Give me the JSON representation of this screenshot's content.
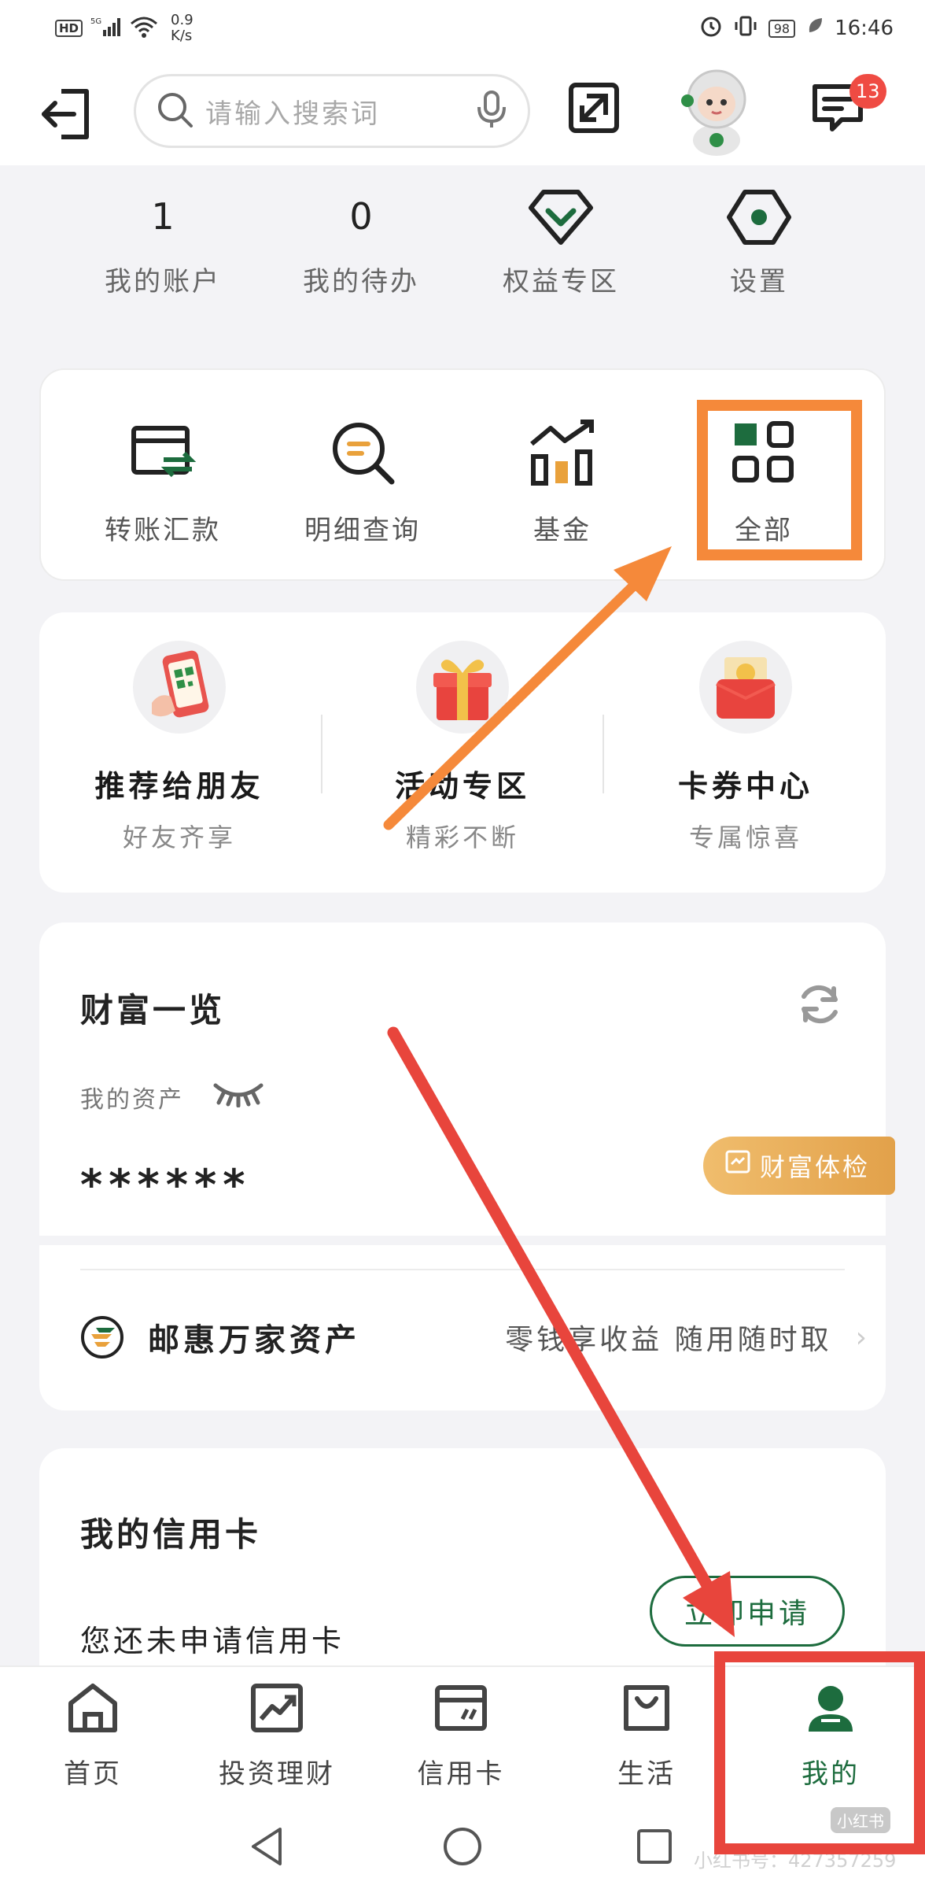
{
  "status_bar": {
    "hd": "HD",
    "signal": "5G",
    "speed_value": "0.9",
    "speed_unit": "K/s",
    "battery": "98",
    "time": "16:46"
  },
  "header": {
    "search_placeholder": "请输入搜索词",
    "notification_count": "13"
  },
  "summary": [
    {
      "value": "1",
      "label": "我的账户"
    },
    {
      "value": "0",
      "label": "我的待办"
    },
    {
      "icon": "diamond-icon",
      "label": "权益专区"
    },
    {
      "icon": "settings-icon",
      "label": "设置"
    }
  ],
  "quick_actions": [
    {
      "icon": "transfer-icon",
      "label": "转账汇款"
    },
    {
      "icon": "statement-search-icon",
      "label": "明细查询"
    },
    {
      "icon": "fund-chart-icon",
      "label": "基金"
    },
    {
      "icon": "grid-all-icon",
      "label": "全部"
    }
  ],
  "promos": [
    {
      "title": "推荐给朋友",
      "subtitle": "好友齐享"
    },
    {
      "title": "活动专区",
      "subtitle": "精彩不断"
    },
    {
      "title": "卡券中心",
      "subtitle": "专属惊喜"
    }
  ],
  "wealth": {
    "title": "财富一览",
    "asset_label": "我的资产",
    "masked_amount": "******",
    "checkup_label": "财富体检",
    "product_name": "邮惠万家资产",
    "product_desc": "零钱享收益 随用随时取"
  },
  "credit": {
    "title": "我的信用卡",
    "empty_text": "您还未申请信用卡",
    "apply_label": "立即申请"
  },
  "bottom_nav": [
    {
      "icon": "home-icon",
      "label": "首页"
    },
    {
      "icon": "investment-icon",
      "label": "投资理财"
    },
    {
      "icon": "credit-card-icon",
      "label": "信用卡"
    },
    {
      "icon": "shopping-bag-icon",
      "label": "生活"
    },
    {
      "icon": "user-icon",
      "label": "我的",
      "active": true
    }
  ],
  "watermark": {
    "tag": "小红书",
    "text": "小红书号：427357259"
  },
  "colors": {
    "brand_green": "#1d6c3e",
    "highlight_orange": "#f5893a",
    "highlight_red": "#e8453c",
    "checkup_gold": "#e9ae5a"
  }
}
